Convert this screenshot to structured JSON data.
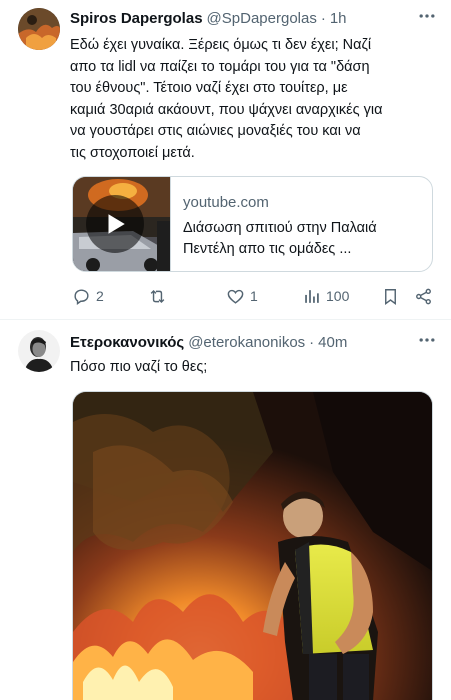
{
  "tweet1": {
    "author_name": "Spiros Dapergolas",
    "handle": "@SpDapergolas",
    "separator": "·",
    "time": "1h",
    "more_icon": "more-horizontal-icon",
    "text": "Εδώ έχει γυναίκα. Ξέρεις όμως τι δεν έχει; Ναζί\nαπο τα lidl να παίζει το τομάρι του για τα \"δάση\nτου έθνους\". Τέτοιο ναζί έχει στο τουίτερ, με\nκαμιά 30αριά ακάουντ, που ψάχνει αναρχικές για\nνα γουστάρει στις αιώνιες μοναξιές του και να\nτις στοχοποιεί μετά.",
    "card": {
      "domain": "youtube.com",
      "title": "Διάσωση σπιτιού στην Παλαιά\nΠεντέλη απο τις ομάδες ...",
      "play_icon": "play-icon"
    },
    "actions": {
      "replies": "2",
      "retweets": "",
      "likes": "1",
      "views": "100"
    }
  },
  "tweet2": {
    "author_name": "Ετεροκανονικός",
    "handle": "@eterokanonikos",
    "separator": "·",
    "time": "40m",
    "more_icon": "more-horizontal-icon",
    "text": "Πόσο πιο ναζί το θες;"
  },
  "colors": {
    "text_primary": "#0f1419",
    "text_secondary": "#536471",
    "border": "#cfd9de",
    "divider": "#eff3f4"
  }
}
